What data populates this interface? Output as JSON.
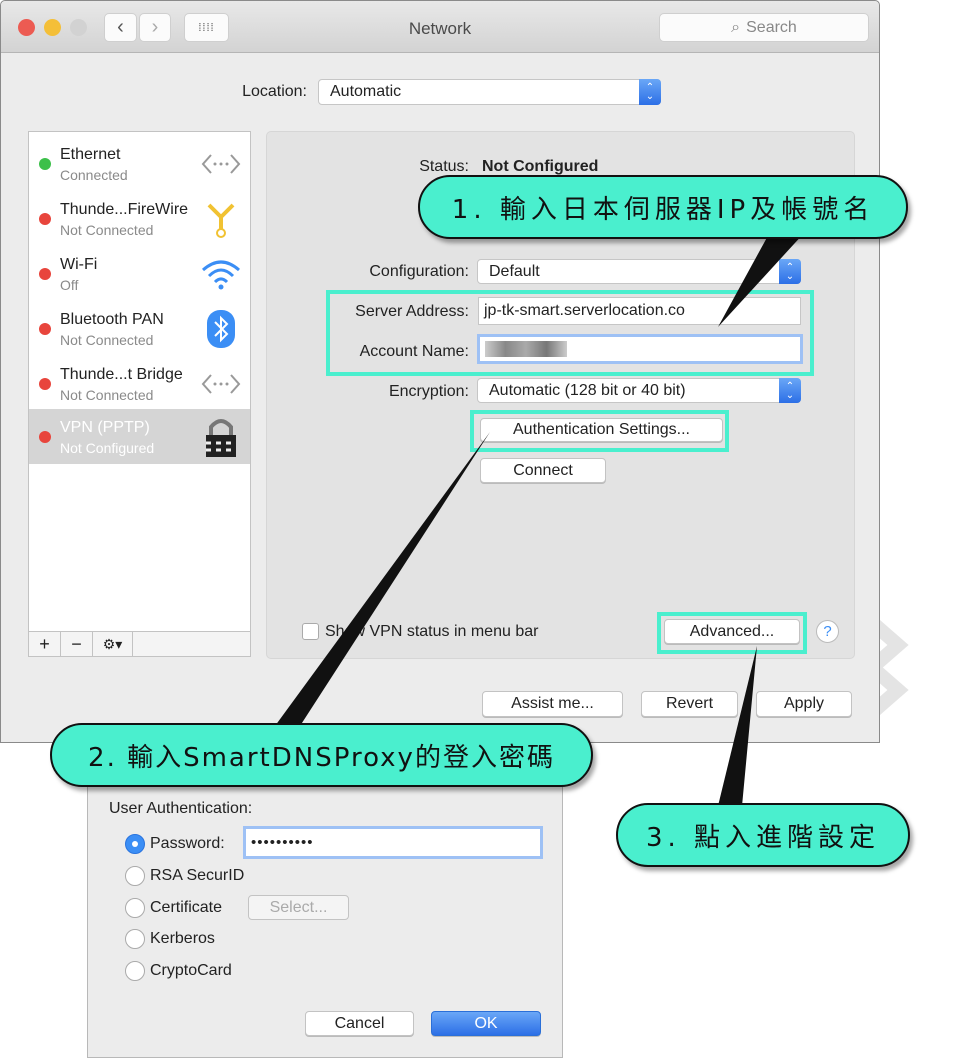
{
  "window": {
    "title": "Network",
    "search_placeholder": "Search"
  },
  "location": {
    "label": "Location:",
    "value": "Automatic"
  },
  "services": [
    {
      "name": "Ethernet",
      "status": "Connected",
      "status_color": "#3cc04a",
      "icon": "ethernet-arrows-icon"
    },
    {
      "name": "Thunde...FireWire",
      "status": "Not Connected",
      "status_color": "#e8453c",
      "icon": "firewire-icon"
    },
    {
      "name": "Wi-Fi",
      "status": "Off",
      "status_color": "#e8453c",
      "icon": "wifi-icon"
    },
    {
      "name": "Bluetooth PAN",
      "status": "Not Connected",
      "status_color": "#e8453c",
      "icon": "bluetooth-icon"
    },
    {
      "name": "Thunde...t Bridge",
      "status": "Not Connected",
      "status_color": "#e8453c",
      "icon": "bridge-arrows-icon"
    },
    {
      "name": "VPN (PPTP)",
      "status": "Not Configured",
      "status_color": "#e8453c",
      "icon": "vpn-lock-icon",
      "selected": true
    }
  ],
  "sidebar_buttons": {
    "add": "+",
    "remove": "−",
    "gear": "⚙▾"
  },
  "detail": {
    "status_label": "Status:",
    "status_value": "Not Configured",
    "configuration_label": "Configuration:",
    "configuration_value": "Default",
    "server_label": "Server Address:",
    "server_value": "jp-tk-smart.serverlocation.co",
    "account_label": "Account Name:",
    "account_value": "",
    "encryption_label": "Encryption:",
    "encryption_value": "Automatic (128 bit or 40 bit)",
    "auth_button": "Authentication Settings...",
    "connect_button": "Connect",
    "show_vpn_label": "Show VPN status in menu bar",
    "advanced_button": "Advanced...",
    "help": "?"
  },
  "footer": {
    "assist": "Assist me...",
    "revert": "Revert",
    "apply": "Apply"
  },
  "callouts": {
    "step1": "1. 輸入日本伺服器IP及帳號名",
    "step2": "2. 輸入SmartDNSProxy的登入密碼",
    "step3": "3. 點入進階設定"
  },
  "auth_dialog": {
    "title": "User Authentication:",
    "options": [
      "Password:",
      "RSA SecurID",
      "Certificate",
      "Kerberos",
      "CryptoCard"
    ],
    "selected": "Password:",
    "password_value": "••••••••••",
    "select_button": "Select...",
    "cancel": "Cancel",
    "ok": "OK"
  },
  "colors": {
    "highlight": "#4aefce",
    "accent": "#3b8ef5"
  }
}
